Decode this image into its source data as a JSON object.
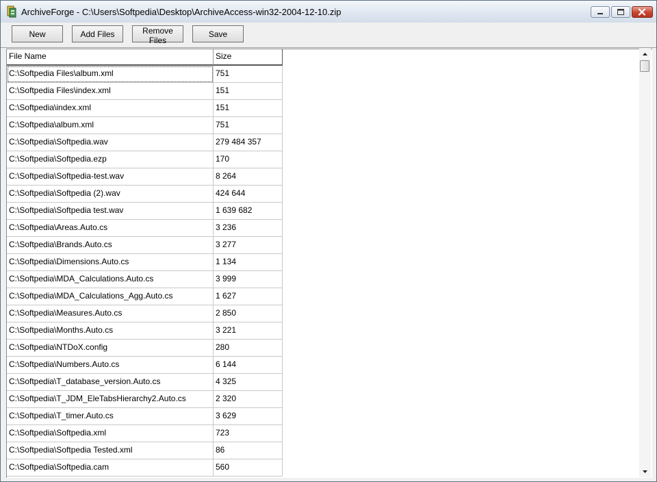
{
  "window": {
    "title": "ArchiveForge - C:\\Users\\Softpedia\\Desktop\\ArchiveAccess-win32-2004-12-10.zip",
    "app_icon": "archiveforge-app-icon",
    "caption_buttons": [
      "minimize-icon",
      "maximize-icon",
      "close-icon"
    ],
    "close_color": "#c7452f"
  },
  "toolbar": {
    "new_label": "New",
    "add_files_label": "Add Files",
    "remove_files_label": "Remove Files",
    "save_label": "Save"
  },
  "file_list": {
    "columns": [
      "File Name",
      "Size"
    ],
    "rows": [
      {
        "name": "C:\\Softpedia Files\\album.xml",
        "size": "751"
      },
      {
        "name": "C:\\Softpedia Files\\index.xml",
        "size": "151"
      },
      {
        "name": "C:\\Softpedia\\index.xml",
        "size": "151"
      },
      {
        "name": "C:\\Softpedia\\album.xml",
        "size": "751"
      },
      {
        "name": "C:\\Softpedia\\Softpedia.wav",
        "size": "279 484 357"
      },
      {
        "name": "C:\\Softpedia\\Softpedia.ezp",
        "size": "170"
      },
      {
        "name": "C:\\Softpedia\\Softpedia-test.wav",
        "size": "8 264"
      },
      {
        "name": "C:\\Softpedia\\Softpedia (2).wav",
        "size": "424 644"
      },
      {
        "name": "C:\\Softpedia\\Softpedia test.wav",
        "size": "1 639 682"
      },
      {
        "name": "C:\\Softpedia\\Areas.Auto.cs",
        "size": "3 236"
      },
      {
        "name": "C:\\Softpedia\\Brands.Auto.cs",
        "size": "3 277"
      },
      {
        "name": "C:\\Softpedia\\Dimensions.Auto.cs",
        "size": "1 134"
      },
      {
        "name": "C:\\Softpedia\\MDA_Calculations.Auto.cs",
        "size": "3 999"
      },
      {
        "name": "C:\\Softpedia\\MDA_Calculations_Agg.Auto.cs",
        "size": "1 627"
      },
      {
        "name": "C:\\Softpedia\\Measures.Auto.cs",
        "size": "2 850"
      },
      {
        "name": "C:\\Softpedia\\Months.Auto.cs",
        "size": "3 221"
      },
      {
        "name": "C:\\Softpedia\\NTDoX.config",
        "size": "280"
      },
      {
        "name": "C:\\Softpedia\\Numbers.Auto.cs",
        "size": "6 144"
      },
      {
        "name": "C:\\Softpedia\\T_database_version.Auto.cs",
        "size": "4 325"
      },
      {
        "name": "C:\\Softpedia\\T_JDM_EleTabsHierarchy2.Auto.cs",
        "size": "2 320"
      },
      {
        "name": "C:\\Softpedia\\T_timer.Auto.cs",
        "size": "3 629"
      },
      {
        "name": "C:\\Softpedia\\Softpedia.xml",
        "size": "723"
      },
      {
        "name": "C:\\Softpedia\\Softpedia Tested.xml",
        "size": "86"
      },
      {
        "name": "C:\\Softpedia\\Softpedia.cam",
        "size": "560"
      }
    ]
  },
  "scrollbar": {
    "icons": [
      "scroll-up-arrow-icon",
      "scroll-down-arrow-icon"
    ]
  }
}
